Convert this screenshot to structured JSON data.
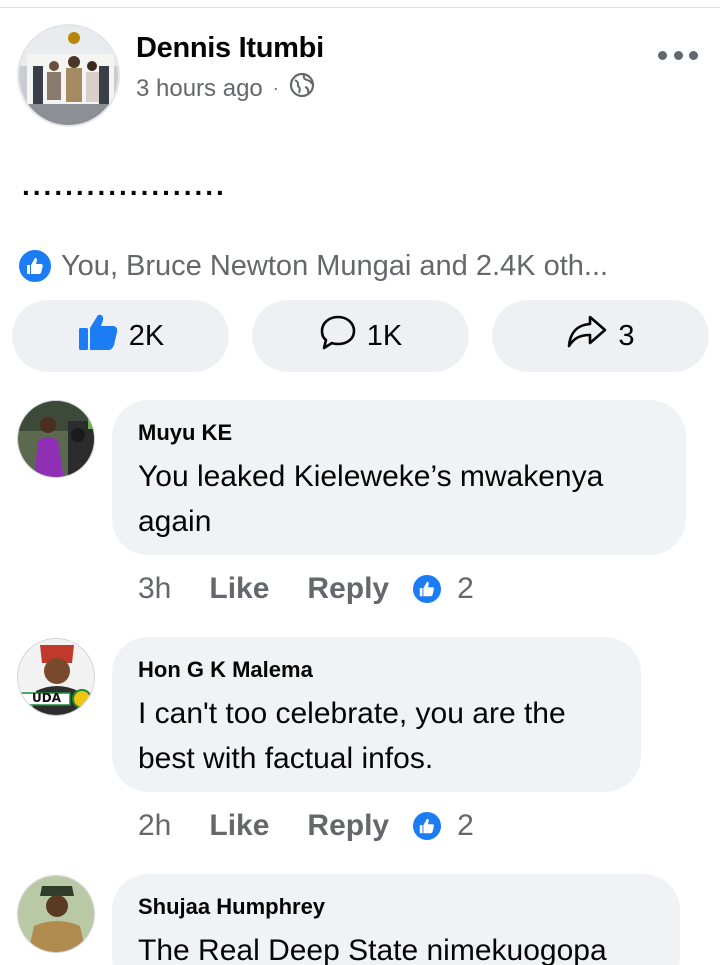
{
  "post": {
    "author": "Dennis Itumbi",
    "time": "3 hours ago",
    "separator": "·",
    "body": "...................",
    "reactions_summary": "You, Bruce Newton Mungai and 2.4K oth...",
    "more_icon": "more-horizontal-icon",
    "privacy_icon": "globe-icon"
  },
  "actions": {
    "like_count": "2K",
    "comment_count": "1K",
    "share_count": "3"
  },
  "comments": [
    {
      "name": "Muyu KE",
      "text": "You leaked Kieleweke’s mwakenya again",
      "time": "3h",
      "like_label": "Like",
      "reply_label": "Reply",
      "likes": "2"
    },
    {
      "name": "Hon G K Malema",
      "text": "I can't too celebrate, you are the best with factual infos.",
      "time": "2h",
      "like_label": "Like",
      "reply_label": "Reply",
      "likes": "2",
      "avatar_text": "UDA"
    },
    {
      "name": "Shujaa Humphrey",
      "text": "The Real Deep State nimekuogopa"
    }
  ],
  "colors": {
    "accent": "#1b7cf3",
    "muted": "#65676b",
    "bubble": "#f0f2f5",
    "button": "#eef0f3"
  }
}
